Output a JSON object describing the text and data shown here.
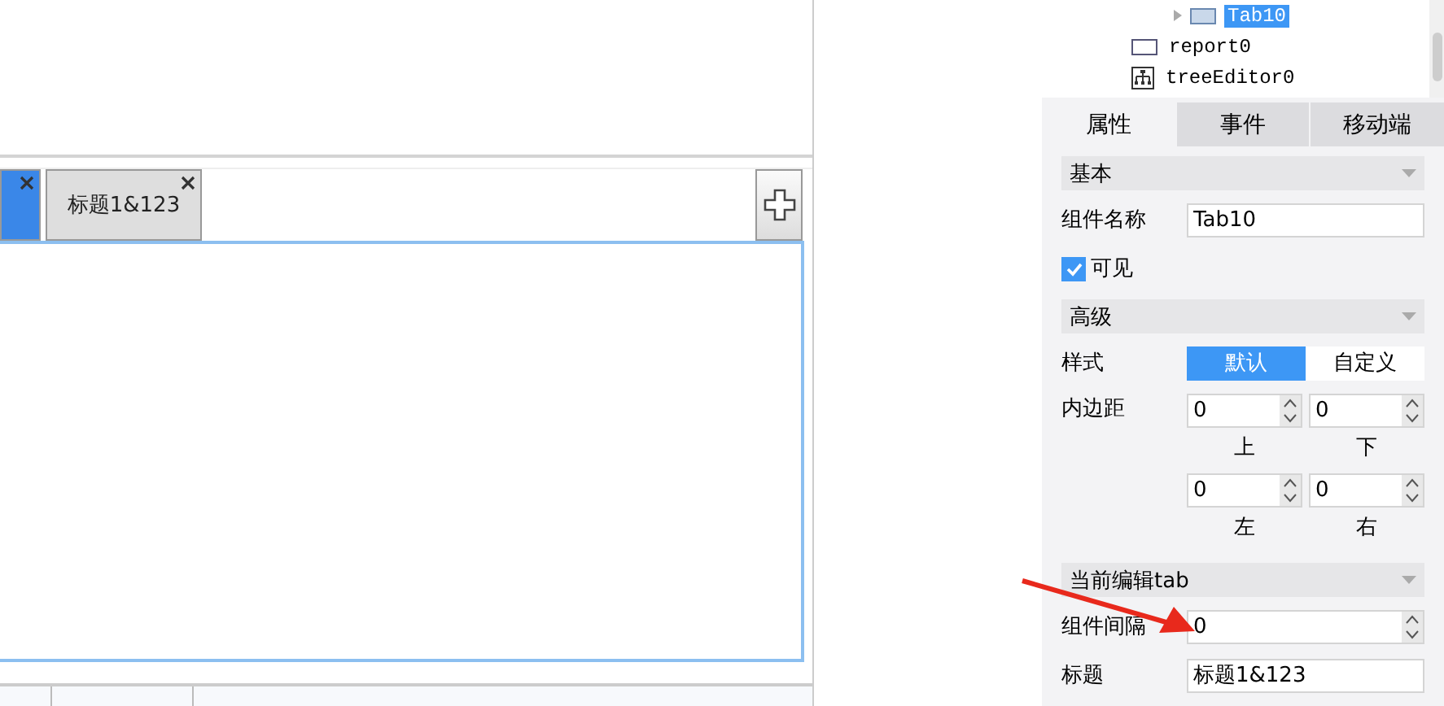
{
  "canvas": {
    "tabs": [
      {
        "selected": true
      },
      {
        "label": "标题1&123",
        "selected": false
      }
    ]
  },
  "tree": [
    {
      "label": "Tab10",
      "kind": "tab",
      "selected": true
    },
    {
      "label": "report0",
      "kind": "report",
      "selected": false
    },
    {
      "label": "treeEditor0",
      "kind": "tree",
      "selected": false
    }
  ],
  "panel_tabs": [
    {
      "label": "属性",
      "selected": true
    },
    {
      "label": "事件",
      "selected": false
    },
    {
      "label": "移动端",
      "selected": false
    }
  ],
  "sections": [
    {
      "title": "基本",
      "rows": [
        {
          "kind": "text",
          "label": "组件名称",
          "value": "Tab10"
        },
        {
          "kind": "checkbox",
          "label": "可见",
          "checked": true
        }
      ]
    },
    {
      "title": "高级",
      "rows": [
        {
          "kind": "segmented",
          "label": "样式",
          "options": [
            {
              "label": "默认",
              "selected": true
            },
            {
              "label": "自定义",
              "selected": false
            }
          ]
        },
        {
          "kind": "padding",
          "label": "内边距",
          "cells": [
            {
              "value": "0",
              "caption": "上"
            },
            {
              "value": "0",
              "caption": "下"
            },
            {
              "value": "0",
              "caption": "左"
            },
            {
              "value": "0",
              "caption": "右"
            }
          ]
        }
      ]
    },
    {
      "title": "当前编辑tab",
      "rows": [
        {
          "kind": "spinner",
          "label": "组件间隔",
          "value": "0"
        },
        {
          "kind": "text",
          "label": "标题",
          "value": "标题1&123"
        }
      ]
    }
  ],
  "annotation": {
    "kind": "arrow"
  }
}
